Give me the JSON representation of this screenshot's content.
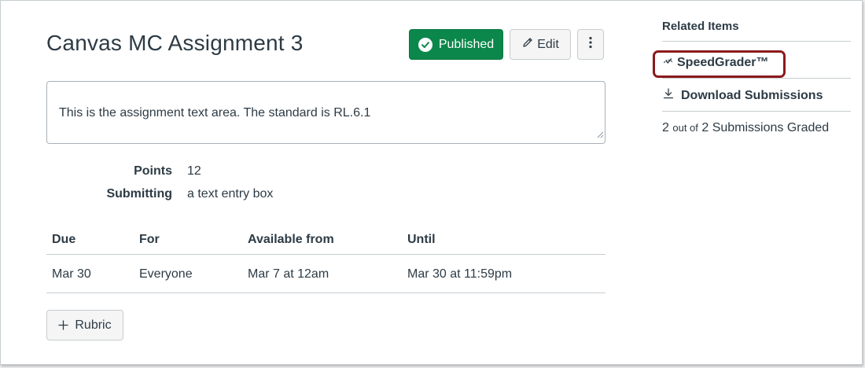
{
  "assignment": {
    "title": "Canvas MC Assignment 3",
    "published_label": "Published",
    "edit_label": "Edit",
    "description": "This is the assignment text area. The standard is RL.6.1"
  },
  "details": {
    "points_label": "Points",
    "points_value": "12",
    "submitting_label": "Submitting",
    "submitting_value": "a text entry box"
  },
  "dates_table": {
    "headers": [
      "Due",
      "For",
      "Available from",
      "Until"
    ],
    "rows": [
      [
        "Mar 30",
        "Everyone",
        "Mar 7 at 12am",
        "Mar 30 at 11:59pm"
      ]
    ]
  },
  "rubric_label": "Rubric",
  "sidebar": {
    "heading": "Related Items",
    "speedgrader_label": "SpeedGrader™",
    "download_label": "Download Submissions",
    "graded_count": "2",
    "graded_out_of": "out of",
    "graded_total": "2 Submissions Graded"
  },
  "colors": {
    "published_green": "#0b874b",
    "highlight_box": "#8c1a1c",
    "text": "#2d3b45"
  },
  "icons": {
    "published": "check-circle-icon",
    "edit": "pencil-icon",
    "more": "kebab-icon",
    "speedgrader": "speedgrader-icon",
    "download": "download-icon",
    "rubric": "plus-icon"
  }
}
